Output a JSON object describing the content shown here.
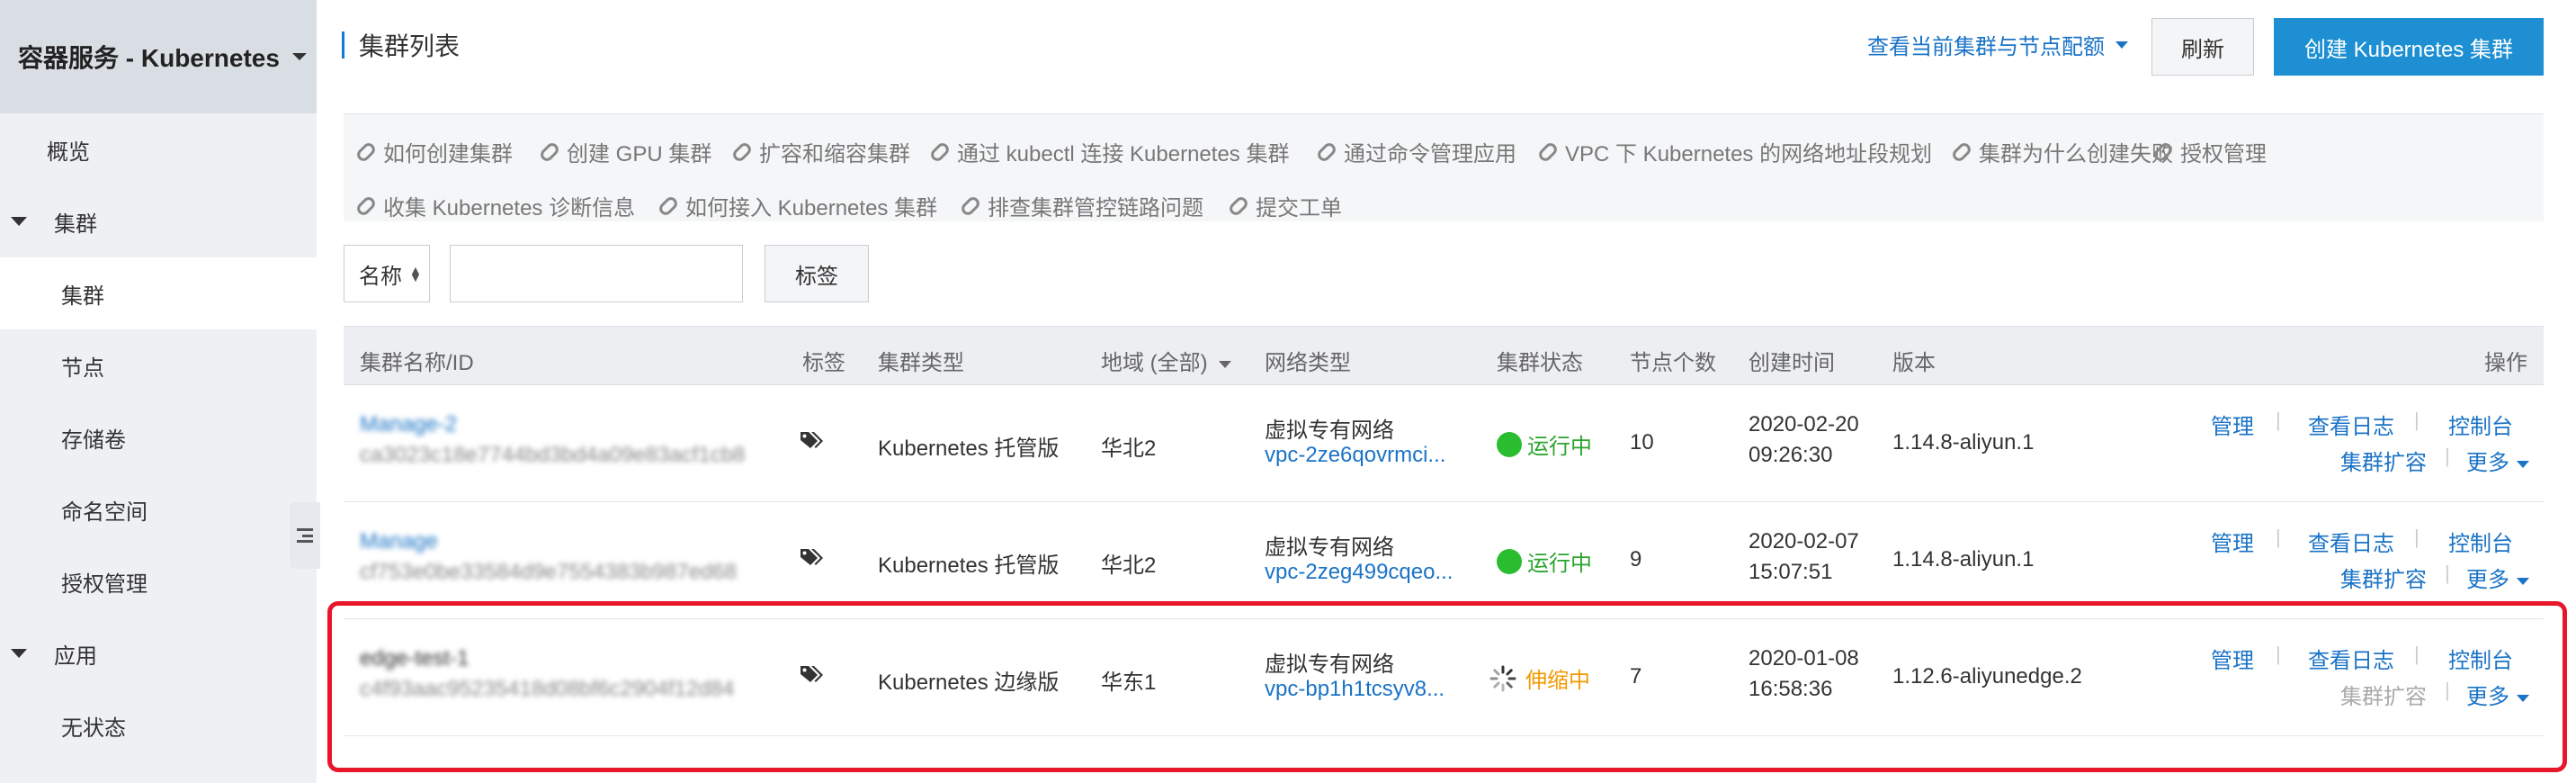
{
  "sidebar": {
    "header": "容器服务 - Kubernetes",
    "items": [
      {
        "label": "概览",
        "type": "l1"
      },
      {
        "label": "集群",
        "type": "group"
      },
      {
        "label": "集群",
        "type": "child",
        "active": true
      },
      {
        "label": "节点",
        "type": "child"
      },
      {
        "label": "存储卷",
        "type": "child"
      },
      {
        "label": "命名空间",
        "type": "child"
      },
      {
        "label": "授权管理",
        "type": "child"
      },
      {
        "label": "应用",
        "type": "group"
      },
      {
        "label": "无状态",
        "type": "child"
      }
    ]
  },
  "header": {
    "title": "集群列表",
    "quota_link": "查看当前集群与节点配额",
    "refresh_label": "刷新",
    "create_label": "创建 Kubernetes 集群"
  },
  "help_links": [
    "如何创建集群",
    "创建 GPU 集群",
    "扩容和缩容集群",
    "通过 kubectl 连接 Kubernetes 集群",
    "通过命令管理应用",
    "VPC 下 Kubernetes 的网络地址段规划",
    "集群为什么创建失败",
    "授权管理",
    "收集 Kubernetes 诊断信息",
    "如何接入 Kubernetes 集群",
    "排查集群管控链路问题",
    "提交工单"
  ],
  "filter": {
    "select_value": "名称",
    "search_value": "",
    "tag_button": "标签"
  },
  "table": {
    "columns": [
      "集群名称/ID",
      "标签",
      "集群类型",
      "地域 (全部)",
      "网络类型",
      "集群状态",
      "节点个数",
      "创建时间",
      "版本",
      "操作"
    ],
    "rows": [
      {
        "name": "Manage-2",
        "id": "ca3023c18e7744bd3bd4a09e83acf1cb8",
        "cluster_type": "Kubernetes 托管版",
        "region": "华北2",
        "network": "虚拟专有网络",
        "vpc": "vpc-2ze6qovrmci...",
        "status": "运行中",
        "nodes": "10",
        "created_date": "2020-02-20",
        "created_time": "09:26:30",
        "version": "1.14.8-aliyun.1",
        "ops": {
          "manage": "管理",
          "logs": "查看日志",
          "console": "控制台",
          "scale": "集群扩容",
          "more": "更多"
        }
      },
      {
        "name": "Manage",
        "id": "cf753e0be33584d9e7554383b987ed68",
        "cluster_type": "Kubernetes 托管版",
        "region": "华北2",
        "network": "虚拟专有网络",
        "vpc": "vpc-2zeg499cqeo...",
        "status": "运行中",
        "nodes": "9",
        "created_date": "2020-02-07",
        "created_time": "15:07:51",
        "version": "1.14.8-aliyun.1",
        "ops": {
          "manage": "管理",
          "logs": "查看日志",
          "console": "控制台",
          "scale": "集群扩容",
          "more": "更多"
        }
      },
      {
        "name": "edge-test-1",
        "id": "c4f93aac95235418d08bf6c2904f12d84",
        "cluster_type": "Kubernetes 边缘版",
        "region": "华东1",
        "network": "虚拟专有网络",
        "vpc": "vpc-bp1h1tcsyv8...",
        "status": "伸缩中",
        "nodes": "7",
        "created_date": "2020-01-08",
        "created_time": "16:58:36",
        "version": "1.12.6-aliyunedge.2",
        "ops": {
          "manage": "管理",
          "logs": "查看日志",
          "console": "控制台",
          "scale": "集群扩容",
          "more": "更多"
        }
      }
    ]
  },
  "colors": {
    "primary": "#1d8fd2",
    "link": "#1a73c6",
    "running": "#2bbd30",
    "scaling": "#f29900",
    "highlight": "#e8162a"
  }
}
